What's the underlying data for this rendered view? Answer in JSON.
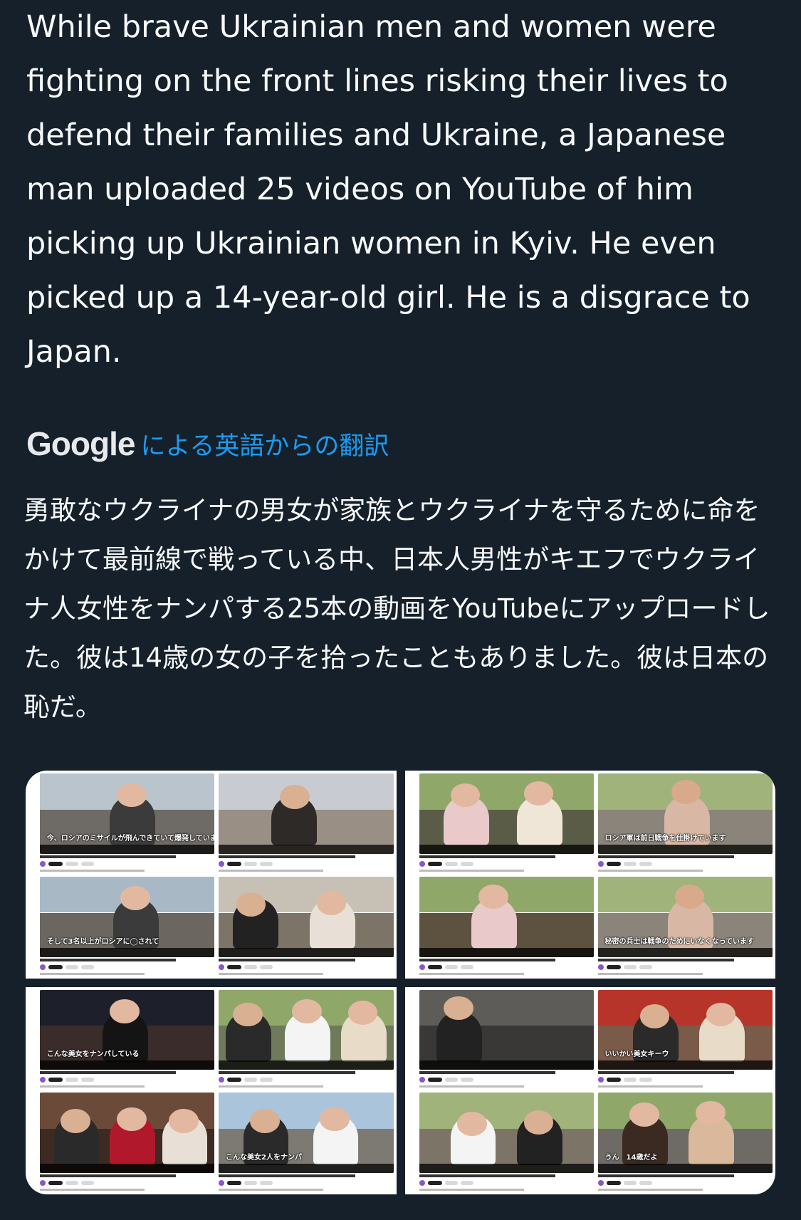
{
  "tweet": {
    "text": "While brave Ukrainian men and women were fighting on the front lines risking their lives to defend their families and Ukraine, a Japanese man uploaded 25 videos on YouTube of him picking up Ukrainian women in Kyiv. He even picked up a 14-year-old girl. He is a disgrace to Japan."
  },
  "translation": {
    "provider_logo": "Google",
    "label": "による英語からの翻訳",
    "text": "勇敢なウクライナの男女が家族とウクライナを守るために命をかけて最前線で戦っている中、日本人男性がキエフでウクライナ人女性をナンパする25本の動画をYouTubeにアップロードした。彼は14歳の女の子を拾ったこともありました。彼は日本の恥だ。"
  },
  "media": {
    "captions": {
      "c1": "今、ロシアのミサイルが飛んできていて爆発しています",
      "c2": "そして3名以上がロシアに◯されて",
      "c3": "ロシア軍は前日戦争を仕掛けています",
      "c4": "秘密の兵士は戦争のためにいなくなっています",
      "c5": "こんな美女をナンパしている",
      "c6": "こんな美女2人をナンパ",
      "c7": "うん　14歳だよ",
      "c8": "いいかい美女キーウ"
    },
    "colors": {
      "street_sky": "#b9c4cc",
      "street_ground": "#6e6a66",
      "park_sky": "#8fa86a",
      "park_ground": "#5a5c48",
      "night_sky": "#1d1f2a",
      "night_ground": "#3a2c2a",
      "skin": "#e2b9a0",
      "hair_dark": "#2b211c",
      "hair_light": "#b58a58"
    }
  }
}
